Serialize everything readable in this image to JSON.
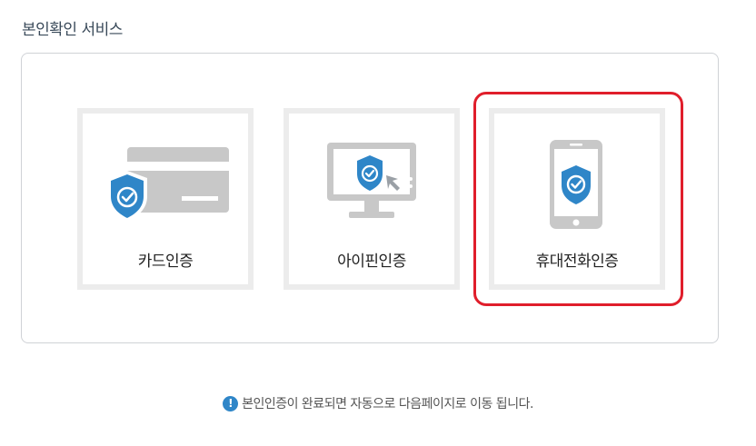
{
  "section": {
    "title": "본인확인 서비스"
  },
  "options": [
    {
      "label": "카드인증",
      "icon": "credit-card-shield-icon",
      "selected": false
    },
    {
      "label": "아이핀인증",
      "icon": "monitor-shield-icon",
      "selected": false
    },
    {
      "label": "휴대전화인증",
      "icon": "phone-shield-icon",
      "selected": true
    }
  ],
  "notice": {
    "icon": "info-icon",
    "icon_glyph": "!",
    "text": "본인인증이 완료되면 자동으로 다음페이지로 이동 됩니다."
  },
  "colors": {
    "shield": "#2f86c8",
    "device": "#c8c8c8",
    "selected_border": "#e01e2b",
    "tile_border": "#ececec"
  }
}
